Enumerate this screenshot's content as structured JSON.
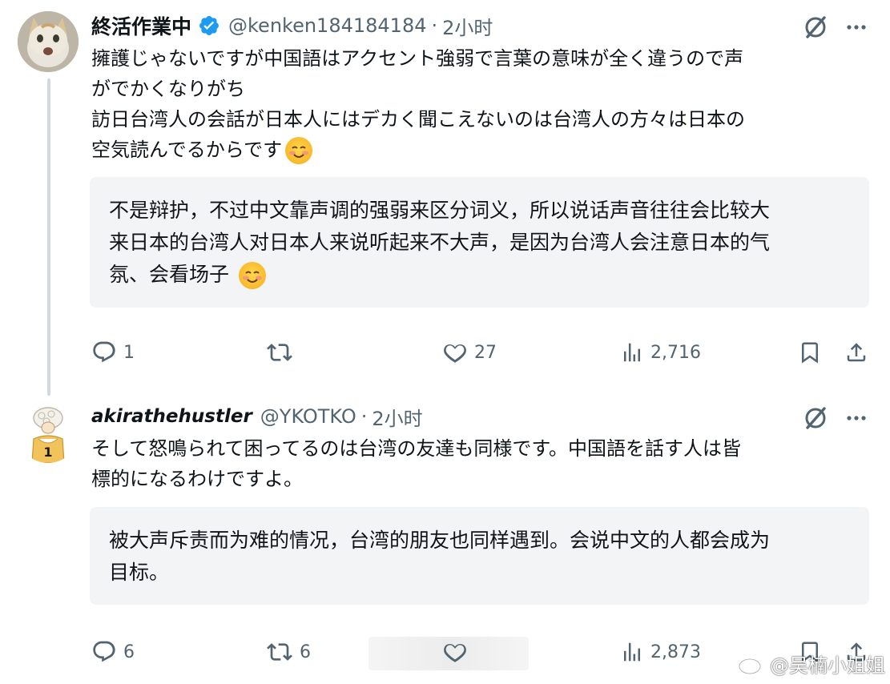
{
  "tweets": [
    {
      "name": "終活作業中",
      "handle": "@kenken184184184",
      "separator": "·",
      "time": "2小时",
      "body_lines": [
        "擁護じゃないですが中国語はアクセント強弱で言葉の意味が全く違うので声",
        "がでかくなりがち",
        "訪日台湾人の会話が日本人にはデカく聞こえないのは台湾人の方々は日本の",
        "空気読んでるからです"
      ],
      "translation_lines": [
        "不是辩护，不过中文靠声调的强弱来区分词义，所以说话声音往往会比较大",
        "来日本的台湾人对日本人来说听起来不大声，是因为台湾人会注意日本的气",
        "氛、会看场子"
      ],
      "actions": {
        "replies": "1",
        "retweets": "",
        "likes": "27",
        "views": "2,716"
      }
    },
    {
      "name": "akirathehustler",
      "handle": "@YKOTKO",
      "separator": "·",
      "time": "2小时",
      "body_lines": [
        "そして怒鳴られて困ってるのは台湾の友達も同様です。中国語を話す人は皆",
        "標的になるわけですよ。"
      ],
      "translation_lines": [
        "被大声斥责而为难的情况，台湾的朋友也同样遇到。会说中文的人都会成为",
        "目标。"
      ],
      "actions": {
        "replies": "6",
        "retweets": "6",
        "likes": "",
        "views": "2,873"
      }
    }
  ],
  "watermark": "@吴楠小姐姐",
  "colors": {
    "text": "#0f1419",
    "secondary": "#536471",
    "verified": "#1d9bf0",
    "translation_bg": "#f3f4f6",
    "thread_line": "#cfd9de"
  },
  "icons": [
    "verified-badge-icon",
    "grok-icon",
    "more-icon",
    "reply-icon",
    "retweet-icon",
    "like-icon",
    "views-icon",
    "bookmark-icon",
    "share-icon",
    "weibo-icon",
    "emoji-smiling-blush-icon"
  ]
}
